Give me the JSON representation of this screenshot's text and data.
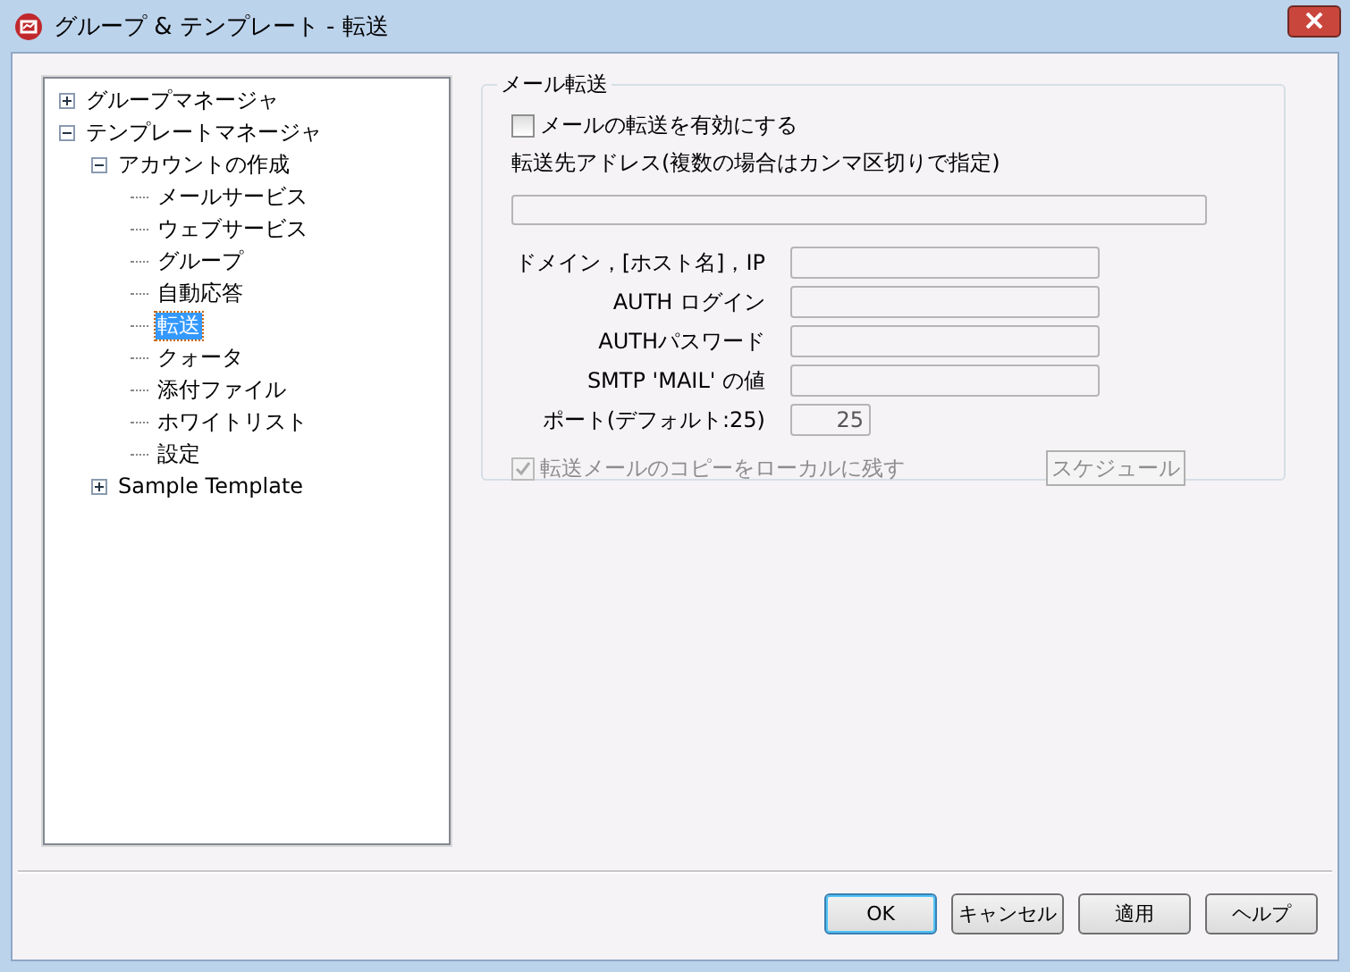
{
  "window": {
    "title": "グループ & テンプレート - 転送"
  },
  "tree": [
    {
      "label": "グループマネージャ",
      "expanded": false,
      "selected": false
    },
    {
      "label": "テンプレートマネージャ",
      "expanded": true,
      "selected": false,
      "children": [
        {
          "label": "アカウントの作成",
          "expanded": true,
          "selected": false,
          "children": [
            {
              "label": "メールサービス",
              "selected": false
            },
            {
              "label": "ウェブサービス",
              "selected": false
            },
            {
              "label": "グループ",
              "selected": false
            },
            {
              "label": "自動応答",
              "selected": false
            },
            {
              "label": "転送",
              "selected": true
            },
            {
              "label": "クォータ",
              "selected": false
            },
            {
              "label": "添付ファイル",
              "selected": false
            },
            {
              "label": "ホワイトリスト",
              "selected": false
            },
            {
              "label": "設定",
              "selected": false
            }
          ]
        },
        {
          "label": "Sample Template",
          "expanded": false,
          "selected": false
        }
      ]
    }
  ],
  "group": {
    "title": "メール転送",
    "enable": {
      "label": "メールの転送を有効にする",
      "checked": false,
      "disabled": false
    },
    "address_label": "転送先アドレス(複数の場合はカンマ区切りで指定)",
    "fields": [
      {
        "label": "ドメイン，[ホスト名]，IP",
        "kind": "text"
      },
      {
        "label": "AUTH ログイン",
        "kind": "text"
      },
      {
        "label": "AUTHパスワード",
        "kind": "text"
      },
      {
        "label": "SMTP 'MAIL' の値",
        "kind": "text"
      },
      {
        "label": "ポート(デフォルト:25)",
        "kind": "port",
        "value": "25"
      }
    ],
    "keep_copy": {
      "label": "転送メールのコピーをローカルに残す",
      "checked": true,
      "disabled": true
    },
    "schedule": {
      "label": "スケジュール",
      "disabled": true
    }
  },
  "buttons": [
    {
      "label": "OK",
      "default": true
    },
    {
      "label": "キャンセル",
      "default": false
    },
    {
      "label": "適用",
      "default": false
    },
    {
      "label": "ヘルプ",
      "default": false
    }
  ]
}
